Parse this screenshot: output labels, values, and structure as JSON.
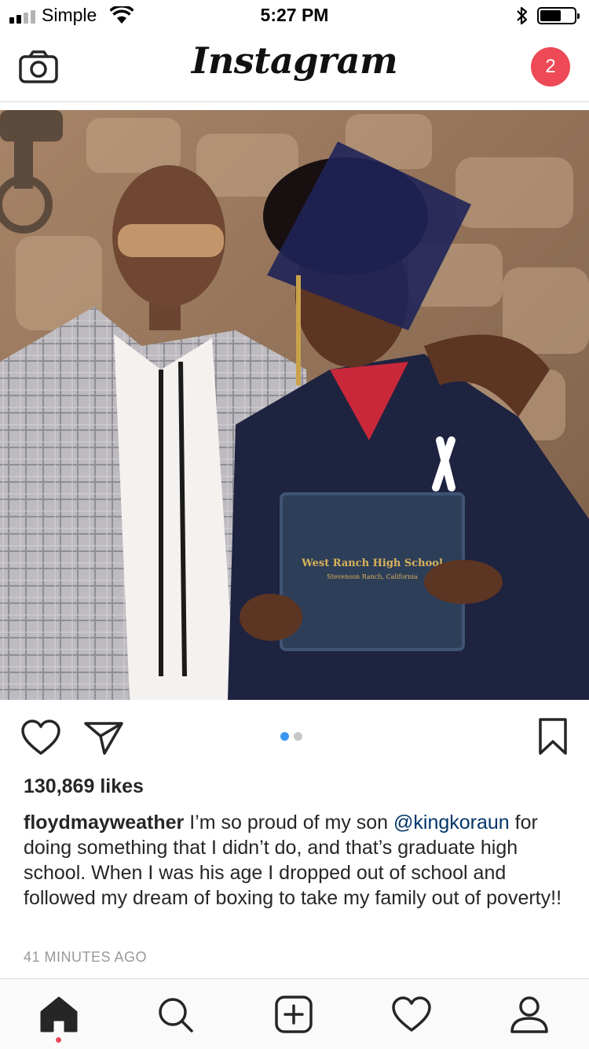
{
  "status_bar": {
    "carrier": "Simple",
    "time": "5:27 PM"
  },
  "header": {
    "logo": "Instagram",
    "notification_count": "2",
    "icons": {
      "left": "camera-icon"
    }
  },
  "post": {
    "photo": {
      "description_icons": [
        "father",
        "graduate-son"
      ],
      "diploma_line1": "West Ranch High School",
      "diploma_line2": "Stevenson Ranch, California"
    },
    "carousel": {
      "total": 2,
      "active": 1
    },
    "actions": [
      "heart-icon",
      "share-icon",
      "bookmark-icon"
    ],
    "likes": "130,869 likes",
    "caption": {
      "username": "floydmayweather",
      "text_before_mention": " I’m so proud of my son ",
      "mention": "@kingkoraun",
      "text_after_mention": " for doing something that I didn’t do, and that’s graduate high school. When I was his age I dropped out of school and followed my dream of boxing to take my family out of poverty!!"
    },
    "timestamp": "41 MINUTES AGO"
  },
  "bottom_nav": {
    "items": [
      "home-icon",
      "search-icon",
      "add-icon",
      "heart-icon",
      "profile-icon"
    ],
    "active": "home-icon"
  },
  "colors": {
    "badge": "#ed4956",
    "dot_active": "#3897f0",
    "mention": "#003569"
  }
}
